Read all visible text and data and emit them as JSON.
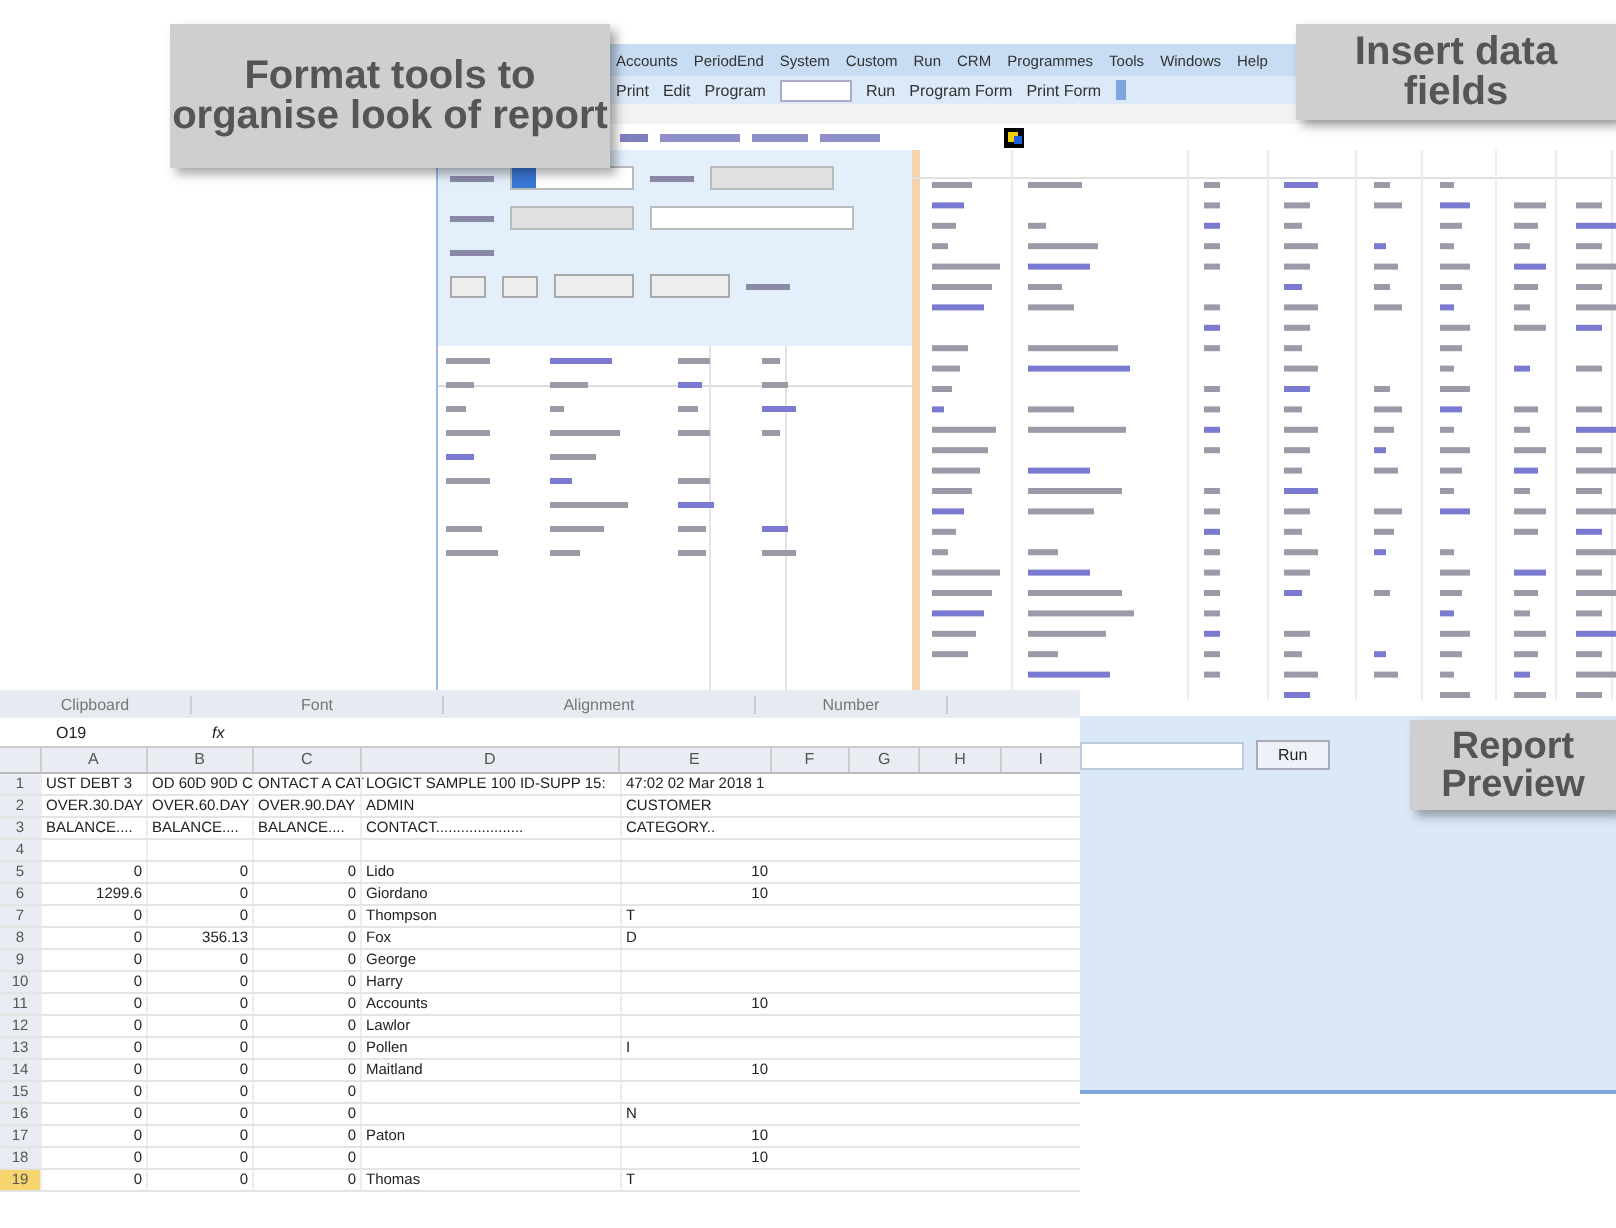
{
  "app": {
    "menu": [
      "Accounts",
      "PeriodEnd",
      "System",
      "Custom",
      "Run",
      "CRM",
      "Programmes",
      "Tools",
      "Windows",
      "Help"
    ],
    "toolbar": [
      {
        "kind": "button",
        "label": "Print"
      },
      {
        "kind": "button",
        "label": "Edit"
      },
      {
        "kind": "label",
        "label": "Program"
      },
      {
        "kind": "input"
      },
      {
        "kind": "button",
        "label": "Run"
      },
      {
        "kind": "button",
        "label": "Program Form"
      },
      {
        "kind": "button",
        "label": "Print Form"
      }
    ],
    "run_button": "Run"
  },
  "spreadsheet": {
    "ribbon_groups": [
      "Clipboard",
      "Font",
      "Alignment",
      "Number"
    ],
    "name_box": "O19",
    "fx": "fx",
    "columns": [
      "A",
      "B",
      "C",
      "D",
      "E",
      "F",
      "G",
      "H",
      "I"
    ],
    "rows": [
      {
        "num": "1",
        "selected": false,
        "cells": [
          {
            "v": "UST DEBT 3",
            "kind": "text"
          },
          {
            "v": "OD 60D 90D C",
            "kind": "text"
          },
          {
            "v": "ONTACT A CAT",
            "kind": "text"
          },
          {
            "v": "LOGICT SAMPLE 100 ID-SUPP 15:",
            "kind": "text"
          },
          {
            "v": "47:02 02 Mar 2018 1",
            "kind": "text"
          }
        ]
      },
      {
        "num": "2",
        "selected": false,
        "cells": [
          {
            "v": "OVER.30.DAY",
            "kind": "text"
          },
          {
            "v": "OVER.60.DAY",
            "kind": "text"
          },
          {
            "v": "OVER.90.DAY",
            "kind": "text"
          },
          {
            "v": "ADMIN",
            "kind": "text"
          },
          {
            "v": "CUSTOMER",
            "kind": "text"
          }
        ]
      },
      {
        "num": "3",
        "selected": false,
        "cells": [
          {
            "v": "BALANCE....",
            "kind": "text"
          },
          {
            "v": "BALANCE....",
            "kind": "text"
          },
          {
            "v": "BALANCE....",
            "kind": "text"
          },
          {
            "v": "CONTACT.....................",
            "kind": "text"
          },
          {
            "v": "CATEGORY..",
            "kind": "text"
          }
        ]
      },
      {
        "num": "4",
        "selected": false,
        "cells": [
          null,
          null,
          null,
          null,
          null
        ]
      },
      {
        "num": "5",
        "selected": false,
        "cells": [
          {
            "v": "0",
            "kind": "number"
          },
          {
            "v": "0",
            "kind": "number"
          },
          {
            "v": "0",
            "kind": "number"
          },
          {
            "v": "Lido",
            "kind": "text"
          },
          {
            "v": "10",
            "kind": "number"
          }
        ]
      },
      {
        "num": "6",
        "selected": false,
        "cells": [
          {
            "v": "1299.6",
            "kind": "number"
          },
          {
            "v": "0",
            "kind": "number"
          },
          {
            "v": "0",
            "kind": "number"
          },
          {
            "v": "Giordano",
            "kind": "text"
          },
          {
            "v": "10",
            "kind": "number"
          }
        ]
      },
      {
        "num": "7",
        "selected": false,
        "cells": [
          {
            "v": "0",
            "kind": "number"
          },
          {
            "v": "0",
            "kind": "number"
          },
          {
            "v": "0",
            "kind": "number"
          },
          {
            "v": "Thompson",
            "kind": "text"
          },
          {
            "v": "T",
            "kind": "text"
          }
        ]
      },
      {
        "num": "8",
        "selected": false,
        "cells": [
          {
            "v": "0",
            "kind": "number"
          },
          {
            "v": "356.13",
            "kind": "number"
          },
          {
            "v": "0",
            "kind": "number"
          },
          {
            "v": "Fox",
            "kind": "text"
          },
          {
            "v": "D",
            "kind": "text"
          }
        ]
      },
      {
        "num": "9",
        "selected": false,
        "cells": [
          {
            "v": "0",
            "kind": "number"
          },
          {
            "v": "0",
            "kind": "number"
          },
          {
            "v": "0",
            "kind": "number"
          },
          {
            "v": "George",
            "kind": "text"
          },
          null
        ]
      },
      {
        "num": "10",
        "selected": false,
        "cells": [
          {
            "v": "0",
            "kind": "number"
          },
          {
            "v": "0",
            "kind": "number"
          },
          {
            "v": "0",
            "kind": "number"
          },
          {
            "v": "Harry",
            "kind": "text"
          },
          null
        ]
      },
      {
        "num": "11",
        "selected": false,
        "cells": [
          {
            "v": "0",
            "kind": "number"
          },
          {
            "v": "0",
            "kind": "number"
          },
          {
            "v": "0",
            "kind": "number"
          },
          {
            "v": "Accounts",
            "kind": "text"
          },
          {
            "v": "10",
            "kind": "number"
          }
        ]
      },
      {
        "num": "12",
        "selected": false,
        "cells": [
          {
            "v": "0",
            "kind": "number"
          },
          {
            "v": "0",
            "kind": "number"
          },
          {
            "v": "0",
            "kind": "number"
          },
          {
            "v": "Lawlor",
            "kind": "text"
          },
          null
        ]
      },
      {
        "num": "13",
        "selected": false,
        "cells": [
          {
            "v": "0",
            "kind": "number"
          },
          {
            "v": "0",
            "kind": "number"
          },
          {
            "v": "0",
            "kind": "number"
          },
          {
            "v": "Pollen",
            "kind": "text"
          },
          {
            "v": "I",
            "kind": "text"
          }
        ]
      },
      {
        "num": "14",
        "selected": false,
        "cells": [
          {
            "v": "0",
            "kind": "number"
          },
          {
            "v": "0",
            "kind": "number"
          },
          {
            "v": "0",
            "kind": "number"
          },
          {
            "v": "Maitland",
            "kind": "text"
          },
          {
            "v": "10",
            "kind": "number"
          }
        ]
      },
      {
        "num": "15",
        "selected": false,
        "cells": [
          {
            "v": "0",
            "kind": "number"
          },
          {
            "v": "0",
            "kind": "number"
          },
          {
            "v": "0",
            "kind": "number"
          },
          null,
          null
        ]
      },
      {
        "num": "16",
        "selected": false,
        "cells": [
          {
            "v": "0",
            "kind": "number"
          },
          {
            "v": "0",
            "kind": "number"
          },
          {
            "v": "0",
            "kind": "number"
          },
          null,
          {
            "v": "N",
            "kind": "text"
          }
        ]
      },
      {
        "num": "17",
        "selected": false,
        "cells": [
          {
            "v": "0",
            "kind": "number"
          },
          {
            "v": "0",
            "kind": "number"
          },
          {
            "v": "0",
            "kind": "number"
          },
          {
            "v": "Paton",
            "kind": "text"
          },
          {
            "v": "10",
            "kind": "number"
          }
        ]
      },
      {
        "num": "18",
        "selected": false,
        "cells": [
          {
            "v": "0",
            "kind": "number"
          },
          {
            "v": "0",
            "kind": "number"
          },
          {
            "v": "0",
            "kind": "number"
          },
          null,
          {
            "v": "10",
            "kind": "number"
          }
        ]
      },
      {
        "num": "19",
        "selected": true,
        "cells": [
          {
            "v": "0",
            "kind": "number"
          },
          {
            "v": "0",
            "kind": "number"
          },
          {
            "v": "0",
            "kind": "number"
          },
          {
            "v": "Thomas",
            "kind": "text"
          },
          {
            "v": "T",
            "kind": "text"
          }
        ]
      }
    ]
  },
  "callouts": [
    "Format tools to organise look of report",
    "Insert data fields",
    "Report Preview"
  ]
}
